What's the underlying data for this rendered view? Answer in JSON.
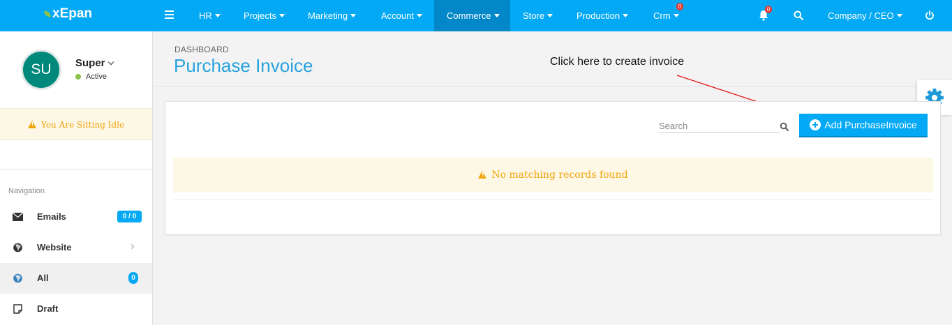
{
  "brand": {
    "name": "xEpan"
  },
  "topnav": {
    "items": [
      {
        "label": "HR"
      },
      {
        "label": "Projects"
      },
      {
        "label": "Marketing"
      },
      {
        "label": "Account"
      },
      {
        "label": "Commerce"
      },
      {
        "label": "Store"
      },
      {
        "label": "Production"
      },
      {
        "label": "Crm",
        "badge": "0"
      }
    ],
    "active_item": "Commerce",
    "notifications_badge": "0",
    "user_menu": "Company / CEO"
  },
  "sidebar": {
    "avatar_initials": "SU",
    "username": "Super",
    "status": "Active",
    "idle_message": "You Are Sitting Idle",
    "nav_label": "Navigation",
    "items": [
      {
        "label": "Emails",
        "icon": "envelope-icon",
        "count": "0 / 0"
      },
      {
        "label": "Website",
        "icon": "globe-icon"
      },
      {
        "label": "All",
        "icon": "globe-icon",
        "count": "0"
      },
      {
        "label": "Draft",
        "icon": "note-icon"
      }
    ]
  },
  "page": {
    "breadcrumb": "DASHBOARD",
    "title": "Purchase Invoice",
    "annotation": "Click here to create invoice"
  },
  "grid": {
    "search_placeholder": "Search",
    "add_button_label": "Add PurchaseInvoice",
    "empty_message": "No matching records found"
  },
  "colors": {
    "primary": "#03a9f4",
    "active_nav": "#0288c8",
    "warning": "#f0a30a",
    "warning_bg": "#fdf8e6",
    "avatar": "#00897b",
    "annotation_arrow": "#e0161b"
  }
}
